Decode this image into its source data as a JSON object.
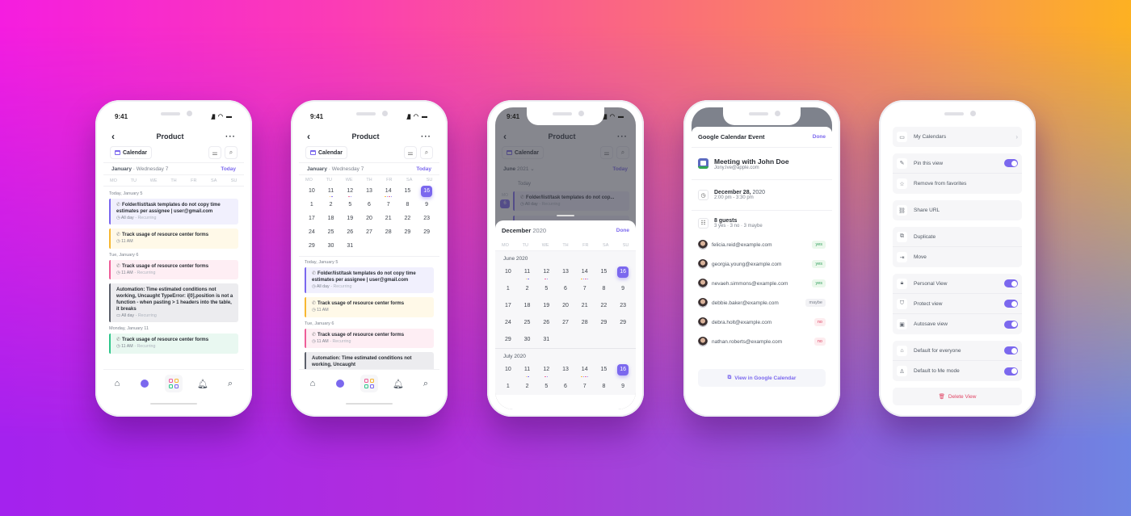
{
  "colors": {
    "accent": "#7b68ee",
    "yes": "#2f9d5a",
    "no": "#e04363"
  },
  "phone1": {
    "time": "9:41",
    "title": "Product",
    "calendar_label": "Calendar",
    "month": "January",
    "day": "Wednesday 7",
    "today": "Today",
    "weekdays": [
      "MO",
      "TU",
      "WE",
      "TH",
      "FR",
      "SA",
      "SU"
    ],
    "sections": [
      {
        "label": "Today, January 5",
        "cards": [
          {
            "title": "Folder/list/task templates do not copy time estimates per assignee | user@gmail.com",
            "time": "All day",
            "recurring": "Recurring",
            "color": "#7b68ee",
            "bg": "#f1f0fd"
          },
          {
            "title": "Track usage of resource center forms",
            "time": "11 AM",
            "recurring": "",
            "color": "#f7b731",
            "bg": "#fff9e8"
          }
        ]
      },
      {
        "label": "Tue, January 6",
        "cards": [
          {
            "title": "Track usage of resource center forms",
            "time": "11 AM",
            "recurring": "Recurring",
            "color": "#ee5e99",
            "bg": "#feeef4"
          },
          {
            "title": "Automation: Time estimated conditions not working, Uncaught TypeError: i[0].position is not a function - when pasting > 1 headers into the table, it breaks",
            "time": "All day",
            "recurring": "Recurring",
            "color": "#5c606b",
            "bg": "#ececef"
          }
        ]
      },
      {
        "label": "Monday, January 11",
        "cards": [
          {
            "title": "Track usage of resource center forms",
            "time": "11 AM",
            "recurring": "Recurring",
            "color": "#2ec68a",
            "bg": "#e9f8f1"
          }
        ]
      }
    ],
    "tabs": [
      "home",
      "inbox",
      "apps",
      "notifications",
      "search"
    ]
  },
  "phone2": {
    "time": "9:41",
    "title": "Product",
    "calendar_label": "Calendar",
    "month": "January",
    "day": "Wednesday 7",
    "today": "Today",
    "weekdays": [
      "MO",
      "TU",
      "WE",
      "TH",
      "FR",
      "SA",
      "SU"
    ],
    "days": [
      "10",
      "11",
      "12",
      "13",
      "14",
      "15",
      "16",
      "1",
      "2",
      "5",
      "6",
      "7",
      "8",
      "9",
      "17",
      "18",
      "19",
      "20",
      "21",
      "22",
      "23",
      "24",
      "25",
      "26",
      "27",
      "28",
      "29",
      "29",
      "29",
      "30",
      "31"
    ],
    "selected_day": "16",
    "sections": [
      {
        "label": "Today, January 5",
        "cards": [
          {
            "title": "Folder/list/task templates do not copy time estimates per assignee | user@gmail.com",
            "time": "All day",
            "recurring": "Recurring",
            "color": "#7b68ee",
            "bg": "#f1f0fd"
          },
          {
            "title": "Track usage of resource center forms",
            "time": "11 AM",
            "recurring": "",
            "color": "#f7b731",
            "bg": "#fff9e8"
          }
        ]
      },
      {
        "label": "Tue, January 6",
        "cards": [
          {
            "title": "Track usage of resource center forms",
            "time": "11 AM",
            "recurring": "Recurring",
            "color": "#ee5e99",
            "bg": "#feeef4"
          },
          {
            "title": "Automation: Time estimated conditions not working, Uncaught",
            "time": "",
            "recurring": "",
            "color": "#5c606b",
            "bg": "#ececef"
          }
        ]
      }
    ]
  },
  "phone3": {
    "time": "9:41",
    "title": "Product",
    "calendar_label": "Calendar",
    "month_picker": "June",
    "month_picker_year": "2021",
    "today": "Today",
    "today_section": "Today",
    "day_abbr": "MO",
    "day_num": "6",
    "background_card": {
      "title": "Folder/list/task templates do not cop...",
      "time": "All day",
      "recurring": "Recurring"
    },
    "sheet": {
      "month": "December",
      "year": "2020",
      "done": "Done",
      "weekdays": [
        "MO",
        "TU",
        "WE",
        "TH",
        "FR",
        "SA",
        "SU"
      ],
      "months": [
        {
          "label": "June 2020",
          "days": [
            "10",
            "11",
            "12",
            "13",
            "14",
            "15",
            "16",
            "1",
            "2",
            "5",
            "6",
            "7",
            "8",
            "9",
            "17",
            "18",
            "19",
            "20",
            "21",
            "22",
            "23",
            "24",
            "25",
            "26",
            "27",
            "28",
            "29",
            "29",
            "29",
            "30",
            "31"
          ]
        },
        {
          "label": "July 2020",
          "days": [
            "10",
            "11",
            "12",
            "13",
            "14",
            "15",
            "16",
            "1",
            "2",
            "5",
            "6",
            "7",
            "8",
            "9"
          ]
        }
      ],
      "selected_day": "16"
    }
  },
  "phone4": {
    "header": "Google Calendar Event",
    "done": "Done",
    "event_title": "Meeting with John Doe",
    "organizer": "Jony.Ive@apple.com",
    "date": "December 28,",
    "year": "2020",
    "time": "2:00 pm - 3:30 pm",
    "guests_count": "8 guests",
    "guests_summary": "3 yes  ·  3 no  ·  3 maybe",
    "guests": [
      {
        "email": "felicia.reid@example.com",
        "rsvp": "yes"
      },
      {
        "email": "georgia.young@example.com",
        "rsvp": "yes"
      },
      {
        "email": "nevaeh.simmons@example.com",
        "rsvp": "yes"
      },
      {
        "email": "debbie.baker@example.com",
        "rsvp": "maybe"
      },
      {
        "email": "debra.holt@example.com",
        "rsvp": "no"
      },
      {
        "email": "nathan.roberts@example.com",
        "rsvp": "no"
      }
    ],
    "view_button": "View in Google Calendar"
  },
  "phone5": {
    "groups": [
      [
        {
          "icon": "calendar-icon",
          "glyph": "▭",
          "label": "My Calendars",
          "control": "chevron"
        }
      ],
      [
        {
          "icon": "pin-icon",
          "glyph": "✎",
          "label": "Pin this view",
          "control": "toggle",
          "on": true
        },
        {
          "icon": "unfavorite-icon",
          "glyph": "☆",
          "label": "Remove from favorites",
          "control": "none"
        }
      ],
      [
        {
          "icon": "link-icon",
          "glyph": "⛓",
          "label": "Share URL",
          "control": "none"
        }
      ],
      [
        {
          "icon": "duplicate-icon",
          "glyph": "⧉",
          "label": "Duplicate",
          "control": "none"
        },
        {
          "icon": "move-icon",
          "glyph": "⇥",
          "label": "Move",
          "control": "none"
        }
      ],
      [
        {
          "icon": "lock-icon",
          "glyph": "🔒︎",
          "label": "Personal View",
          "control": "toggle",
          "on": true
        },
        {
          "icon": "shield-icon",
          "glyph": "⛉",
          "label": "Protect view",
          "control": "toggle",
          "on": true
        },
        {
          "icon": "save-icon",
          "glyph": "▣",
          "label": "Autosave view",
          "control": "toggle",
          "on": true
        }
      ],
      [
        {
          "icon": "home-icon",
          "glyph": "⌂",
          "label": "Default for everyone",
          "control": "toggle",
          "on": true
        },
        {
          "icon": "user-icon",
          "glyph": "♙",
          "label": "Default to Me mode",
          "control": "toggle",
          "on": true
        }
      ]
    ],
    "delete": "Delete View"
  }
}
